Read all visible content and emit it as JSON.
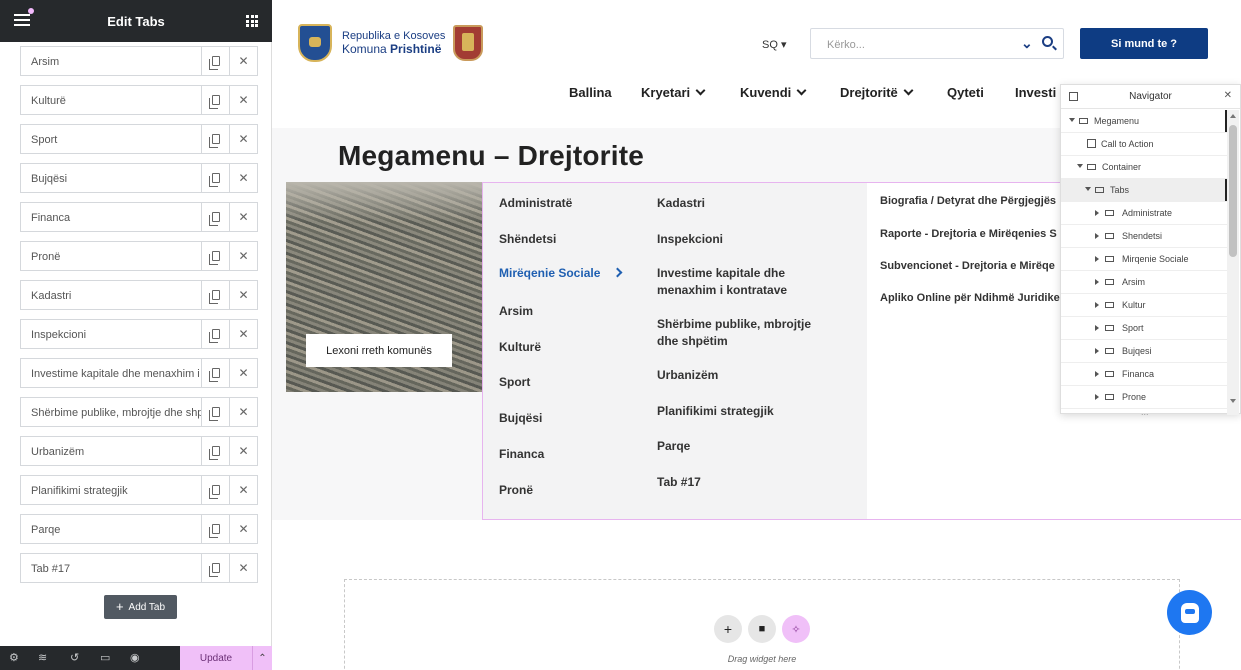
{
  "editor": {
    "title": "Edit Tabs",
    "tabs": [
      {
        "label": "Arsim"
      },
      {
        "label": "Kulturë"
      },
      {
        "label": "Sport"
      },
      {
        "label": "Bujqësi"
      },
      {
        "label": "Financa"
      },
      {
        "label": "Pronë"
      },
      {
        "label": "Kadastri"
      },
      {
        "label": "Inspekcioni"
      },
      {
        "label": "Investime kapitale dhe menaxhim i kontratave"
      },
      {
        "label": "Shërbime publike, mbrojtje dhe shpëtim"
      },
      {
        "label": "Urbanizëm"
      },
      {
        "label": "Planifikimi strategjik"
      },
      {
        "label": "Parqe"
      },
      {
        "label": "Tab #17"
      }
    ],
    "add_tab_label": "Add Tab",
    "update_label": "Update",
    "icons": {
      "duplicate": "copy-icon",
      "remove": "close-icon",
      "footer": [
        "settings-icon",
        "layers-icon",
        "history-icon",
        "responsive-icon",
        "preview-icon"
      ]
    }
  },
  "site": {
    "logo_line1": "Republika e Kosoves",
    "logo_line2_a": "Komuna ",
    "logo_line2_b": "Prishtinë",
    "lang": "SQ ▾",
    "search_placeholder": "Kërko...",
    "cta_label": "Si mund te ?",
    "brand_color": "#0e3c83",
    "nav": [
      "Ballina",
      "Kryetari",
      "Kuvendi",
      "Drejtoritë",
      "Qyteti",
      "Investi"
    ]
  },
  "page": {
    "title": "Megamenu – Drejtorite",
    "read_more_label": "Lexoni rreth komunës",
    "menu_col1": [
      "Administratë",
      "Shëndetsi",
      "Mirëqenie Sociale",
      "Arsim",
      "Kulturë",
      "Sport",
      "Bujqësi",
      "Financa",
      "Pronë"
    ],
    "active_item": "Mirëqenie Sociale",
    "menu_col2": [
      "Kadastri",
      "Inspekcioni",
      "Investime kapitale dhe",
      "menaxhim i kontratave",
      "Shërbime publike, mbrojtje",
      "dhe shpëtim",
      "Urbanizëm",
      "Planifikimi strategjik",
      "Parqe",
      "Tab #17"
    ],
    "menu_col3": [
      "Biografia / Detyrat dhe Përgjegjës",
      "Raporte - Drejtoria e Mirëqenies S",
      "Subvencionet - Drejtoria e Mirëqe",
      "Apliko Online për Ndihmë Juridike"
    ],
    "drop_text": "Drag widget here",
    "accent_color": "#f0c0f8"
  },
  "navigator": {
    "title": "Navigator",
    "rows": [
      "Megamenu",
      "Call to Action",
      "Container",
      "Tabs",
      "Administrate",
      "Shendetsi",
      "Mirqenie Sociale",
      "Arsim",
      "Kultur",
      "Sport",
      "Bujqesi",
      "Financa",
      "Prone"
    ],
    "more": "..."
  }
}
